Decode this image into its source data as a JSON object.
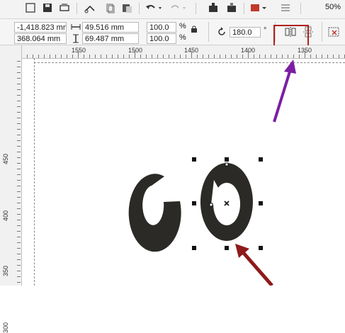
{
  "toolbar": {
    "zoom": "50%",
    "icons": [
      "new-icon",
      "save-icon",
      "print-icon",
      "cut-icon",
      "copy-icon",
      "paste-icon",
      "undo-icon",
      "redo-icon",
      "import-icon",
      "export-icon",
      "publish-icon",
      "launcher-icon"
    ]
  },
  "propbar": {
    "x": "-1,418.823 mn",
    "y": "368.064 mm",
    "width": "49.516 mm",
    "height": "69.487 mm",
    "scale_x": "100.0",
    "scale_y": "100.0",
    "percent_x": "%",
    "percent_y": "%",
    "rotation": "180.0",
    "degree": "°"
  },
  "ruler": {
    "h_labels": [
      "1550",
      "1500",
      "1450",
      "1400",
      "1350"
    ],
    "v_labels": [
      "450",
      "400",
      "350",
      "300"
    ]
  },
  "colors": {
    "shape": "#2b2a27",
    "highlight_box": "#b0211c",
    "arrow_purple": "#7b1fa2",
    "arrow_red": "#8e1a1a"
  }
}
